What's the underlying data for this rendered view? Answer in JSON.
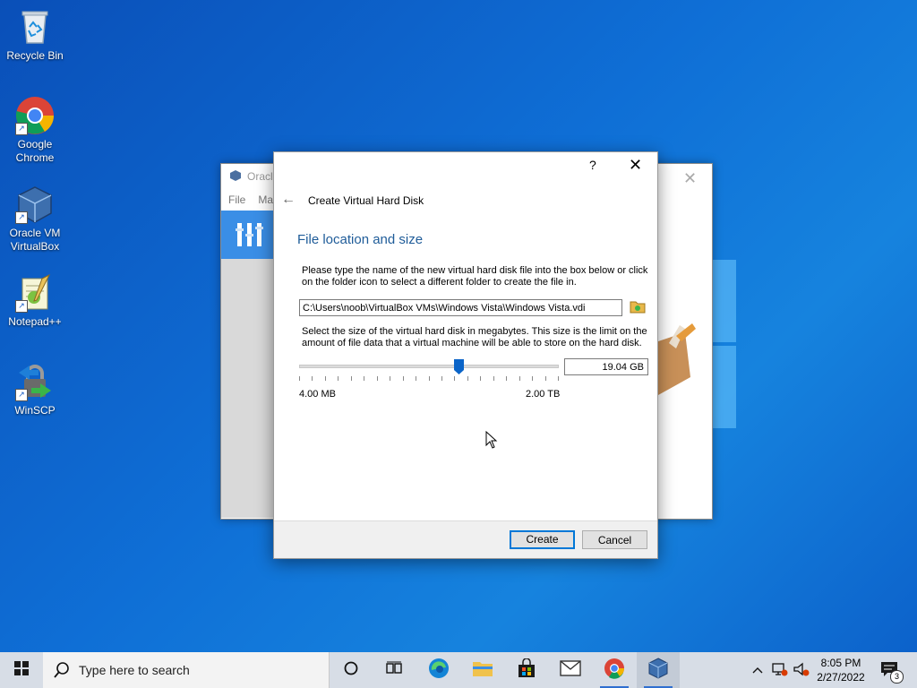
{
  "desktop": {
    "icons": [
      {
        "label": "Recycle Bin"
      },
      {
        "label": "Google Chrome"
      },
      {
        "label": "Oracle VM VirtualBox"
      },
      {
        "label": "Notepad++"
      },
      {
        "label": "WinSCP"
      }
    ]
  },
  "vbox_main": {
    "title": "Oracle",
    "menu": [
      "File",
      "Ma"
    ]
  },
  "dialog": {
    "help_label": "?",
    "title": "Create Virtual Hard Disk",
    "heading": "File location and size",
    "location_description": "Please type the name of the new virtual hard disk file into the box below or click on the folder icon to select a different folder to create the file in.",
    "file_path": "C:\\Users\\noob\\VirtualBox VMs\\Windows Vista\\Windows Vista.vdi",
    "size_description": "Select the size of the virtual hard disk in megabytes. This size is the limit on the amount of file data that a virtual machine will be able to store on the hard disk.",
    "size_value": "19.04 GB",
    "slider_fraction": 0.62,
    "slider_min_label": "4.00 MB",
    "slider_max_label": "2.00 TB",
    "create_label": "Create",
    "cancel_label": "Cancel"
  },
  "taskbar": {
    "search_placeholder": "Type here to search",
    "time": "8:05 PM",
    "date": "2/27/2022",
    "notification_count": "3",
    "apps": [
      "task-view",
      "edge",
      "file-explorer",
      "store",
      "mail",
      "chrome",
      "virtualbox"
    ]
  },
  "colors": {
    "accent": "#0078d7",
    "heading_blue": "#1f5c99",
    "slider_blue": "#0a64c8"
  }
}
